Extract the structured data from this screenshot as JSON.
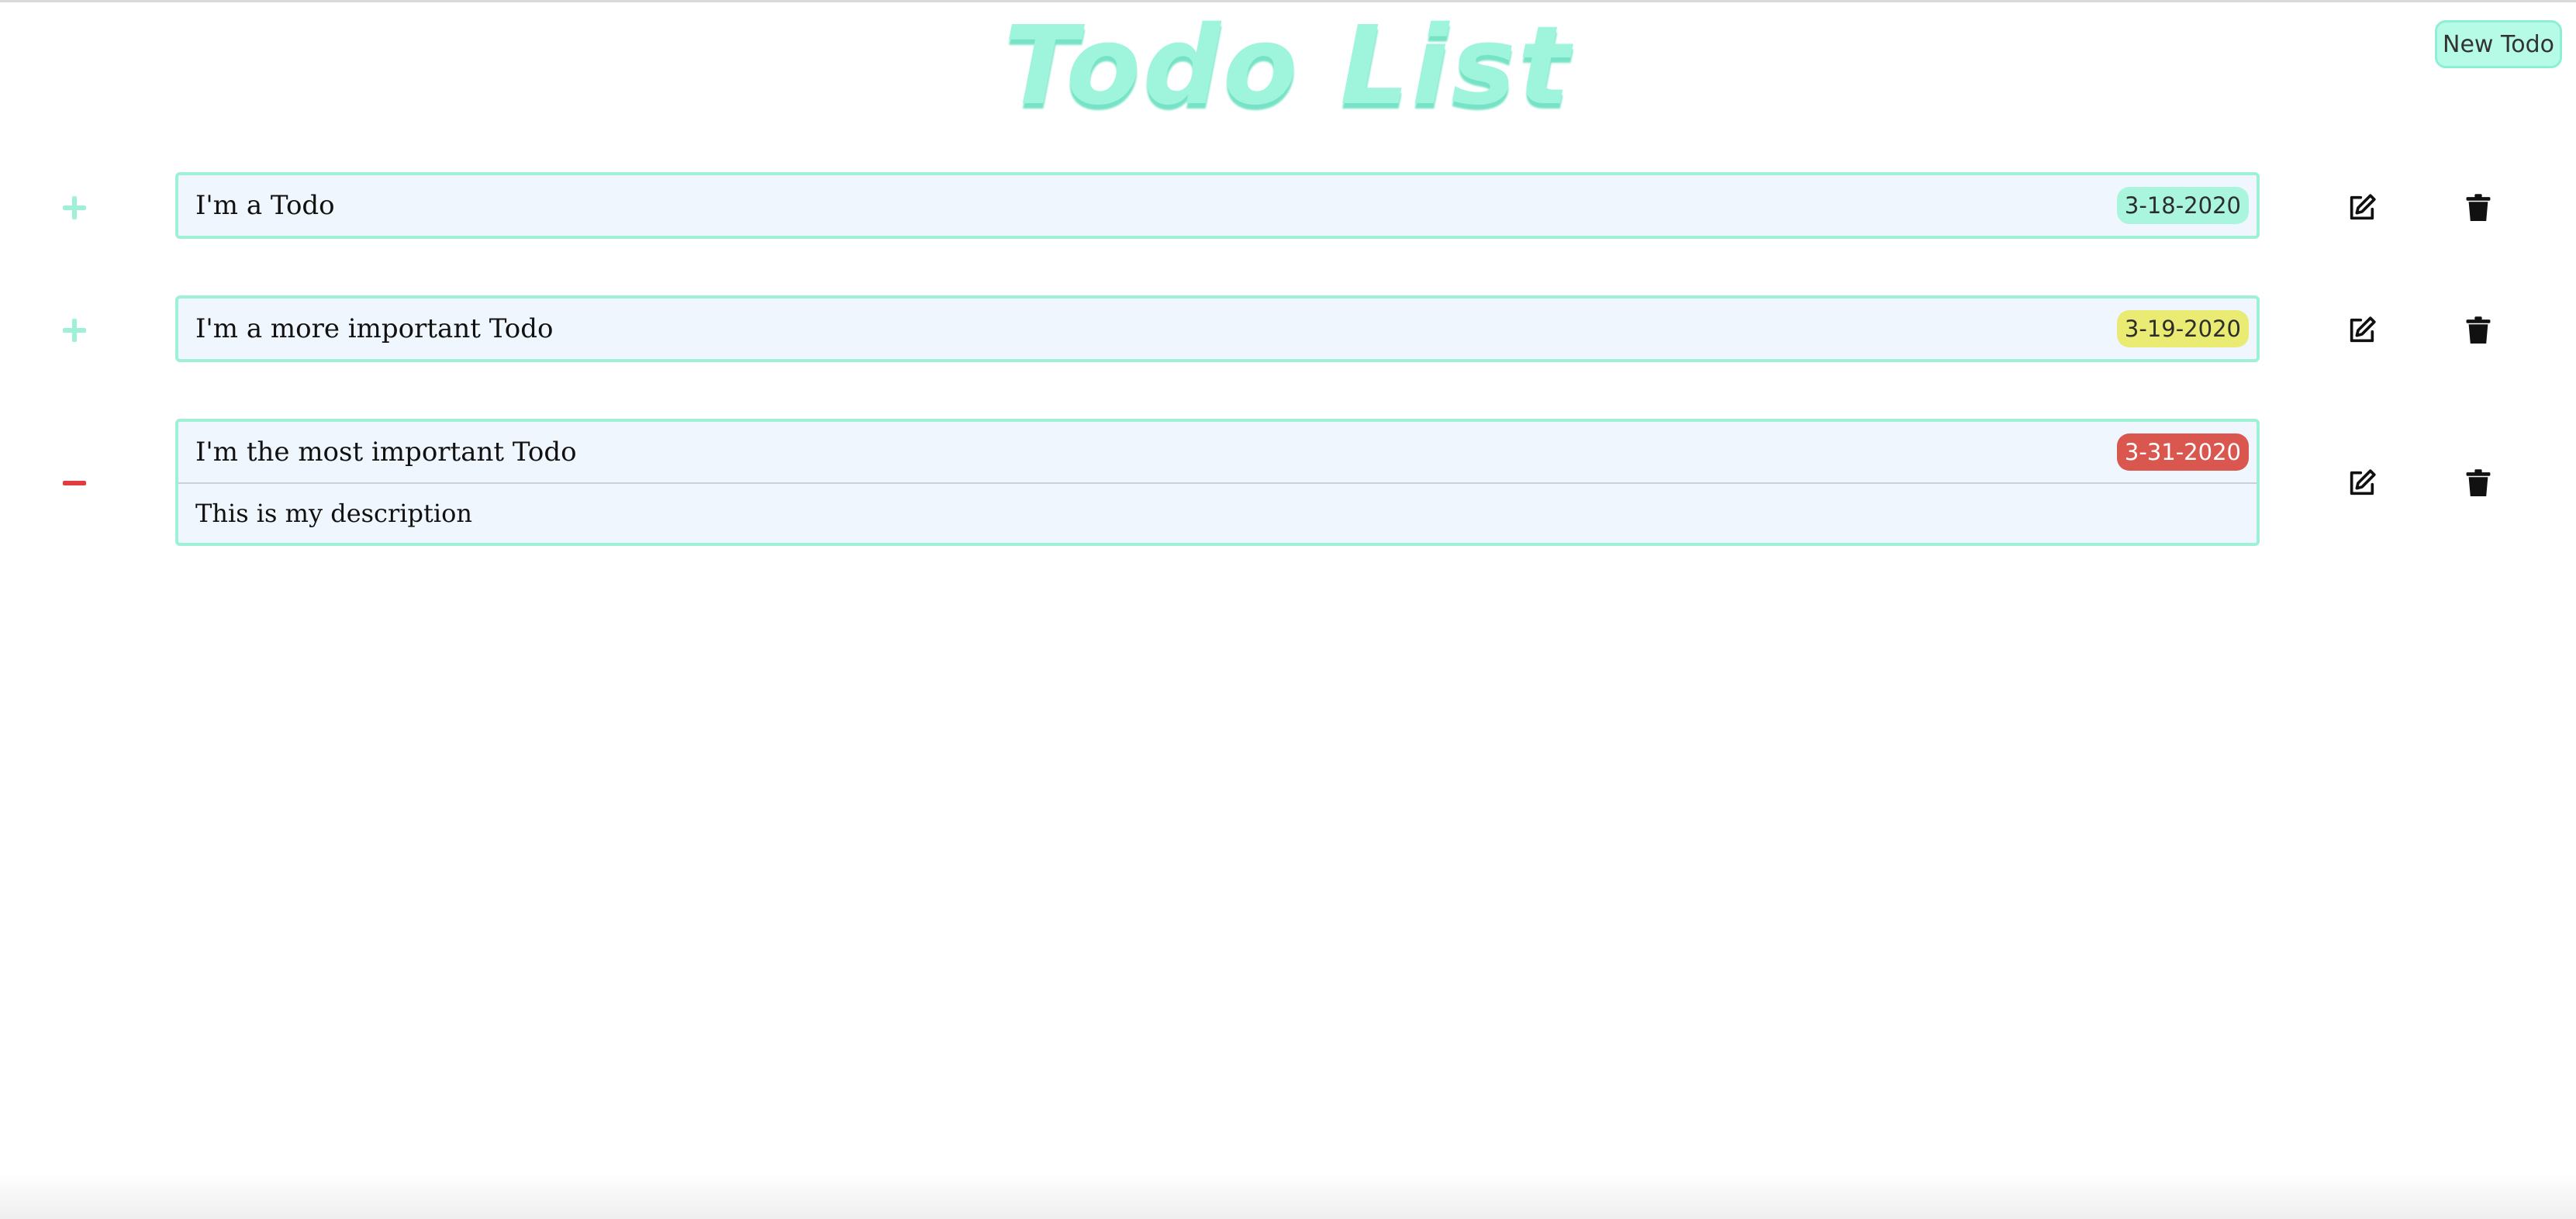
{
  "app": {
    "title": "Todo List",
    "new_todo_label": "New Todo"
  },
  "todos": [
    {
      "title": "I'm a Todo",
      "date": "3-18-2020",
      "badge_color": "#aaf5de",
      "badge_text_color": "#2d2d2d",
      "expanded": false,
      "toggle_icon": "plus-icon"
    },
    {
      "title": "I'm a more important Todo",
      "date": "3-19-2020",
      "badge_color": "#eaeb72",
      "badge_text_color": "#2d2d2d",
      "expanded": false,
      "toggle_icon": "plus-icon"
    },
    {
      "title": "I'm the most important Todo",
      "date": "3-31-2020",
      "badge_color": "#d9574f",
      "badge_text_color": "#ffffff",
      "expanded": true,
      "toggle_icon": "minus-icon",
      "description": "This is my description"
    }
  ],
  "icons": {
    "edit": "edit-icon",
    "delete": "trash-icon"
  },
  "colors": {
    "accent": "#9ff5dc",
    "card_border": "#9ef0d7",
    "card_bg": "#eff6fd",
    "collapse_red": "#e23d3d"
  }
}
